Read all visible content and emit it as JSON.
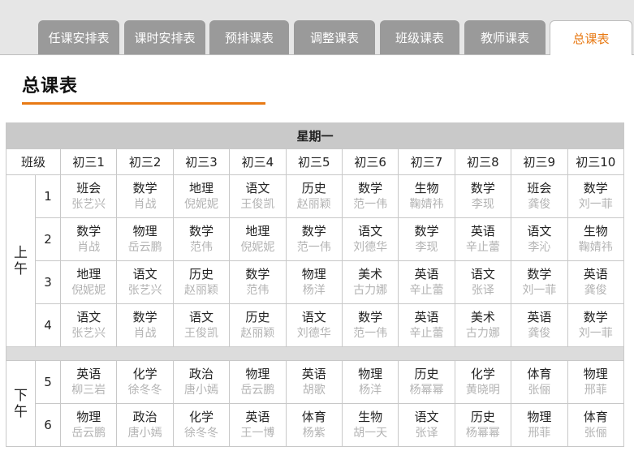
{
  "tabs": [
    {
      "label": "任课安排表",
      "active": false
    },
    {
      "label": "课时安排表",
      "active": false
    },
    {
      "label": "预排课表",
      "active": false
    },
    {
      "label": "调整课表",
      "active": false
    },
    {
      "label": "班级课表",
      "active": false
    },
    {
      "label": "教师课表",
      "active": false
    },
    {
      "label": "总课表",
      "active": true
    }
  ],
  "page_title": "总课表",
  "accent_color": "#e87a14",
  "table": {
    "day": "星期一",
    "class_header": "班级",
    "classes": [
      "初三1",
      "初三2",
      "初三3",
      "初三4",
      "初三5",
      "初三6",
      "初三7",
      "初三8",
      "初三9",
      "初三10"
    ],
    "sections": [
      {
        "label": "上午",
        "rows": [
          {
            "period": "1",
            "cells": [
              {
                "subject": "班会",
                "teacher": "张艺兴"
              },
              {
                "subject": "数学",
                "teacher": "肖战"
              },
              {
                "subject": "地理",
                "teacher": "倪妮妮"
              },
              {
                "subject": "语文",
                "teacher": "王俊凯"
              },
              {
                "subject": "历史",
                "teacher": "赵丽颖"
              },
              {
                "subject": "数学",
                "teacher": "范一伟"
              },
              {
                "subject": "生物",
                "teacher": "鞠婧祎"
              },
              {
                "subject": "数学",
                "teacher": "李现"
              },
              {
                "subject": "班会",
                "teacher": "龚俊"
              },
              {
                "subject": "数学",
                "teacher": "刘一菲"
              }
            ]
          },
          {
            "period": "2",
            "cells": [
              {
                "subject": "数学",
                "teacher": "肖战"
              },
              {
                "subject": "物理",
                "teacher": "岳云鹏"
              },
              {
                "subject": "数学",
                "teacher": "范伟"
              },
              {
                "subject": "地理",
                "teacher": "倪妮妮"
              },
              {
                "subject": "数学",
                "teacher": "范一伟"
              },
              {
                "subject": "语文",
                "teacher": "刘德华"
              },
              {
                "subject": "数学",
                "teacher": "李现"
              },
              {
                "subject": "英语",
                "teacher": "辛止蕾"
              },
              {
                "subject": "语文",
                "teacher": "李沁"
              },
              {
                "subject": "生物",
                "teacher": "鞠婧祎"
              }
            ]
          },
          {
            "period": "3",
            "cells": [
              {
                "subject": "地理",
                "teacher": "倪妮妮"
              },
              {
                "subject": "语文",
                "teacher": "张艺兴"
              },
              {
                "subject": "历史",
                "teacher": "赵丽颖"
              },
              {
                "subject": "数学",
                "teacher": "范伟"
              },
              {
                "subject": "物理",
                "teacher": "杨洋"
              },
              {
                "subject": "美术",
                "teacher": "古力娜"
              },
              {
                "subject": "英语",
                "teacher": "辛止蕾"
              },
              {
                "subject": "语文",
                "teacher": "张译"
              },
              {
                "subject": "数学",
                "teacher": "刘一菲"
              },
              {
                "subject": "英语",
                "teacher": "龚俊"
              }
            ]
          },
          {
            "period": "4",
            "cells": [
              {
                "subject": "语文",
                "teacher": "张艺兴"
              },
              {
                "subject": "数学",
                "teacher": "肖战"
              },
              {
                "subject": "语文",
                "teacher": "王俊凯"
              },
              {
                "subject": "历史",
                "teacher": "赵丽颖"
              },
              {
                "subject": "语文",
                "teacher": "刘德华"
              },
              {
                "subject": "数学",
                "teacher": "范一伟"
              },
              {
                "subject": "英语",
                "teacher": "辛止蕾"
              },
              {
                "subject": "美术",
                "teacher": "古力娜"
              },
              {
                "subject": "英语",
                "teacher": "龚俊"
              },
              {
                "subject": "数学",
                "teacher": "刘一菲"
              }
            ]
          }
        ]
      },
      {
        "label": "下午",
        "rows": [
          {
            "period": "5",
            "cells": [
              {
                "subject": "英语",
                "teacher": "柳三岩"
              },
              {
                "subject": "化学",
                "teacher": "徐冬冬"
              },
              {
                "subject": "政治",
                "teacher": "唐小嫣"
              },
              {
                "subject": "物理",
                "teacher": "岳云鹏"
              },
              {
                "subject": "英语",
                "teacher": "胡歌"
              },
              {
                "subject": "物理",
                "teacher": "杨洋"
              },
              {
                "subject": "历史",
                "teacher": "杨幂幂"
              },
              {
                "subject": "化学",
                "teacher": "黄晓明"
              },
              {
                "subject": "体育",
                "teacher": "张俪"
              },
              {
                "subject": "物理",
                "teacher": "邢菲"
              }
            ]
          },
          {
            "period": "6",
            "cells": [
              {
                "subject": "物理",
                "teacher": "岳云鹏"
              },
              {
                "subject": "政治",
                "teacher": "唐小嫣"
              },
              {
                "subject": "化学",
                "teacher": "徐冬冬"
              },
              {
                "subject": "英语",
                "teacher": "王一博"
              },
              {
                "subject": "体育",
                "teacher": "杨紫"
              },
              {
                "subject": "生物",
                "teacher": "胡一天"
              },
              {
                "subject": "语文",
                "teacher": "张译"
              },
              {
                "subject": "历史",
                "teacher": "杨幂幂"
              },
              {
                "subject": "物理",
                "teacher": "邢菲"
              },
              {
                "subject": "体育",
                "teacher": "张俪"
              }
            ]
          }
        ]
      }
    ]
  }
}
